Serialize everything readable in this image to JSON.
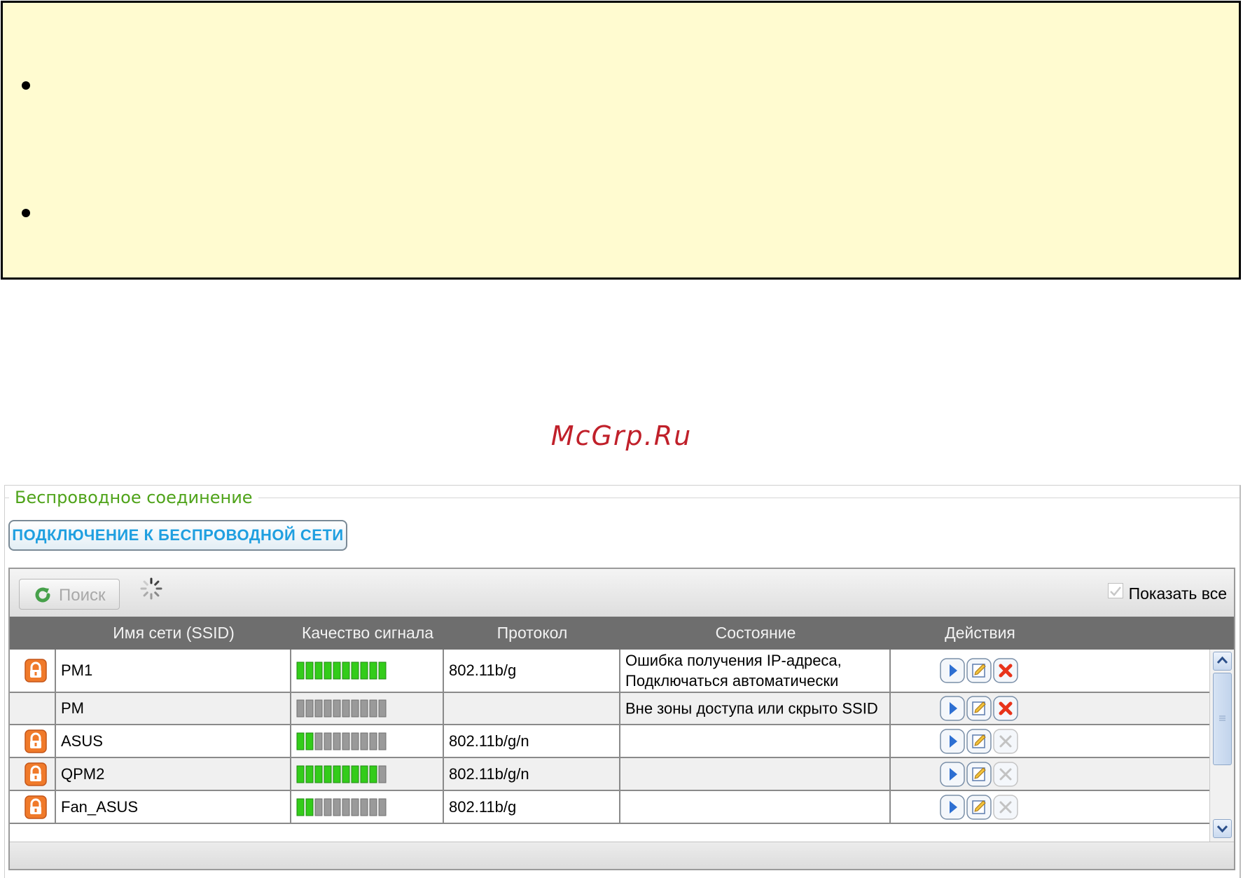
{
  "watermark": "McGrp.Ru",
  "panel": {
    "legend": "Беспроводное соединение",
    "connect_button": "ПОДКЛЮЧЕНИЕ К БЕСПРОВОДНОЙ СЕТИ"
  },
  "toolbar": {
    "search_label": "Поиск",
    "show_all_label": "Показать все",
    "show_all_checked": true
  },
  "columns": [
    "Имя сети (SSID)",
    "Качество сигнала",
    "Протокол",
    "Состояние",
    "Действия"
  ],
  "networks": [
    {
      "secured": true,
      "ssid": "PM1",
      "signal_bars": 10,
      "signal_max": 10,
      "protocol": "802.11b/g",
      "state": [
        "Ошибка получения IP-адреса,",
        "Подключаться автоматически"
      ],
      "delete_enabled": true
    },
    {
      "secured": false,
      "ssid": "PM",
      "signal_bars": 0,
      "signal_max": 10,
      "protocol": "",
      "state": [
        "Вне зоны доступа или скрыто SSID"
      ],
      "delete_enabled": true
    },
    {
      "secured": true,
      "ssid": "ASUS",
      "signal_bars": 2,
      "signal_max": 10,
      "protocol": "802.11b/g/n",
      "state": [],
      "delete_enabled": false
    },
    {
      "secured": true,
      "ssid": "QPM2",
      "signal_bars": 9,
      "signal_max": 10,
      "protocol": "802.11b/g/n",
      "state": [],
      "delete_enabled": false
    },
    {
      "secured": true,
      "ssid": "Fan_ASUS",
      "signal_bars": 2,
      "signal_max": 10,
      "protocol": "802.11b/g",
      "state": [],
      "delete_enabled": false
    }
  ],
  "colors": {
    "note_background": "#fffbd0",
    "legend": "#4fa31a",
    "button_text": "#1f9fe0",
    "header_bg": "#6e6e6e",
    "signal_on": "#33cc1a",
    "signal_off": "#9a9a9a",
    "delete_active": "#e8331a",
    "watermark": "#c0202a"
  },
  "icons": {
    "lock": "lock-icon",
    "connect": "play-icon",
    "edit": "edit-icon",
    "delete": "delete-icon",
    "search": "refresh-icon",
    "spinner": "loading-spinner-icon"
  }
}
